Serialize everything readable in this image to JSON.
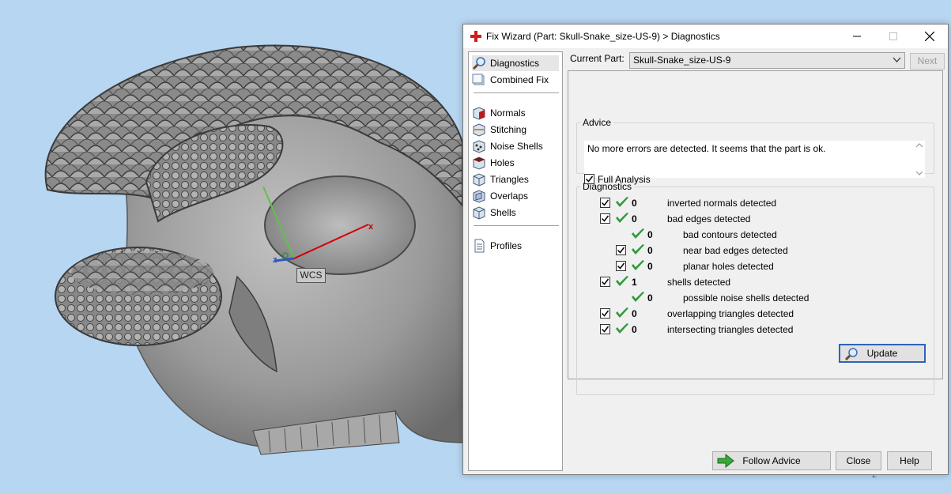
{
  "viewport": {
    "wcs_label": "WCS",
    "axis_x_label": "x",
    "axis_z_label": "z",
    "view_axis_label": "z"
  },
  "dialog": {
    "title": "Fix Wizard (Part: Skull-Snake_size-US-9) > Diagnostics",
    "nav": {
      "items": [
        {
          "label": "Diagnostics",
          "icon": "magnifier-icon"
        },
        {
          "label": "Combined Fix",
          "icon": "combined-fix-icon"
        },
        {
          "label": "Normals",
          "icon": "normals-cube-icon"
        },
        {
          "label": "Stitching",
          "icon": "stitching-cube-icon"
        },
        {
          "label": "Noise Shells",
          "icon": "noise-shells-cube-icon"
        },
        {
          "label": "Holes",
          "icon": "holes-cube-icon"
        },
        {
          "label": "Triangles",
          "icon": "triangles-cube-icon"
        },
        {
          "label": "Overlaps",
          "icon": "overlaps-cube-icon"
        },
        {
          "label": "Shells",
          "icon": "shells-cube-icon"
        },
        {
          "label": "Profiles",
          "icon": "profiles-document-icon"
        }
      ]
    },
    "current_part_label": "Current Part:",
    "current_part_value": "Skull-Snake_size-US-9",
    "next_label": "Next",
    "advice": {
      "legend": "Advice",
      "text": "No more errors are detected. It seems that the part is ok."
    },
    "diagnostics": {
      "legend": "Diagnostics",
      "full_analysis_label": "Full Analysis",
      "rows": [
        {
          "count": "0",
          "label": "inverted normals detected",
          "checkbox": true
        },
        {
          "count": "0",
          "label": "bad edges detected",
          "checkbox": true
        },
        {
          "count": "0",
          "label": "bad contours detected",
          "checkbox": false
        },
        {
          "count": "0",
          "label": "near bad edges detected",
          "checkbox": true
        },
        {
          "count": "0",
          "label": "planar holes detected",
          "checkbox": true
        },
        {
          "count": "1",
          "label": "shells detected",
          "checkbox": true
        },
        {
          "count": "0",
          "label": "possible noise shells detected",
          "checkbox": false
        },
        {
          "count": "0",
          "label": "overlapping triangles detected",
          "checkbox": true
        },
        {
          "count": "0",
          "label": "intersecting triangles detected",
          "checkbox": true
        }
      ],
      "update_label": "Update"
    },
    "follow_advice_label": "Follow Advice",
    "close_label": "Close",
    "help_label": "Help"
  },
  "colors": {
    "background": "#b7d6f2",
    "check_green": "#2f9a3a",
    "axis_x": "#d40000",
    "axis_y": "#5fc24a",
    "axis_z": "#2a59c4",
    "brand_red": "#d61b1b"
  }
}
